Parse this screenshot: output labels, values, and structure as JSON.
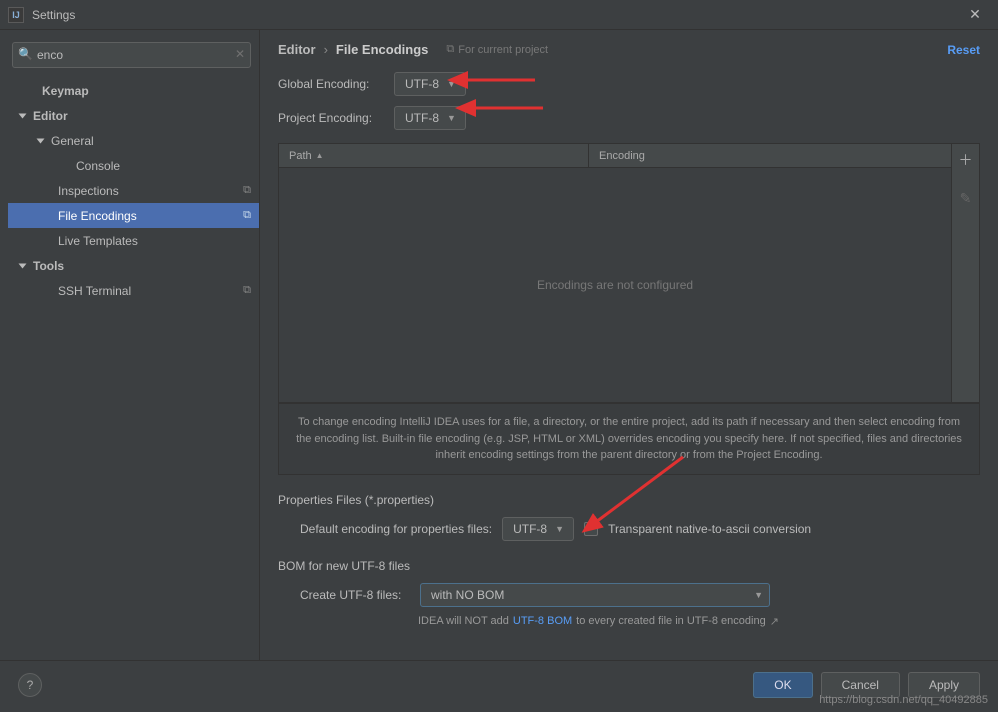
{
  "window": {
    "title": "Settings"
  },
  "search": {
    "value": "enco"
  },
  "tree": {
    "keymap": "Keymap",
    "editor": "Editor",
    "general": "General",
    "console": "Console",
    "inspections": "Inspections",
    "file_encodings": "File Encodings",
    "live_templates": "Live Templates",
    "tools": "Tools",
    "ssh_terminal": "SSH Terminal"
  },
  "breadcrumb": {
    "root": "Editor",
    "current": "File Encodings"
  },
  "scope": "For current project",
  "reset": "Reset",
  "labels": {
    "global": "Global Encoding:",
    "project": "Project Encoding:",
    "path": "Path",
    "encoding": "Encoding",
    "empty": "Encodings are not configured",
    "props_section": "Properties Files (*.properties)",
    "props_label": "Default encoding for properties files:",
    "transparent": "Transparent native-to-ascii conversion",
    "bom_section": "BOM for new UTF-8 files",
    "create_label": "Create UTF-8 files:",
    "bom_hint_pre": "IDEA will NOT add ",
    "bom_hint_link": "UTF-8 BOM",
    "bom_hint_post": " to every created file in UTF-8 encoding"
  },
  "values": {
    "global": "UTF-8",
    "project": "UTF-8",
    "props": "UTF-8",
    "bom": "with NO BOM"
  },
  "info": "To change encoding IntelliJ IDEA uses for a file, a directory, or the entire project, add its path if necessary and then select encoding from the encoding list. Built-in file encoding (e.g. JSP, HTML or XML) overrides encoding you specify here. If not specified, files and directories inherit encoding settings from the parent directory or from the Project Encoding.",
  "buttons": {
    "ok": "OK",
    "cancel": "Cancel",
    "apply": "Apply"
  },
  "watermark": "https://blog.csdn.net/qq_40492885"
}
